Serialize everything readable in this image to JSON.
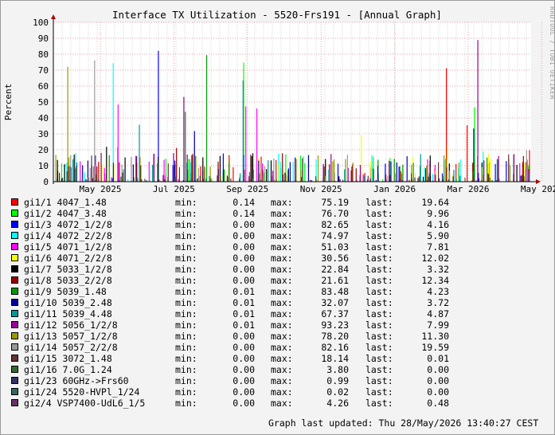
{
  "chart_data": {
    "type": "bar",
    "title": "Interface TX Utilization - 5520-Frs191 - [Annual Graph]",
    "ylabel": "Percent",
    "xlabel": "",
    "ylim": [
      0,
      100
    ],
    "yticks": [
      0,
      10,
      20,
      30,
      40,
      50,
      60,
      70,
      80,
      90,
      100
    ],
    "x_tick_labels": [
      "May 2025",
      "Jul 2025",
      "Sep 2025",
      "Nov 2025",
      "Jan 2026",
      "Mar 2026",
      "May 2026"
    ],
    "grid": true,
    "legend_placement": "bottom",
    "series": [
      {
        "name": "gi1/1 4047_1.48",
        "color": "#ff0000",
        "min": "0.14",
        "max": "75.19",
        "last": "19.64"
      },
      {
        "name": "gi1/2 4047_3.48",
        "color": "#00ff00",
        "min": "0.14",
        "max": "76.70",
        "last": "9.96"
      },
      {
        "name": "gi1/3 4072_1/2/8",
        "color": "#0000ff",
        "min": "0.00",
        "max": "82.65",
        "last": "4.16"
      },
      {
        "name": "gi1/4 4072_2/2/8",
        "color": "#00ffff",
        "min": "0.00",
        "max": "74.97",
        "last": "5.90"
      },
      {
        "name": "gi1/5 4071_1/2/8",
        "color": "#ff00ff",
        "min": "0.00",
        "max": "51.03",
        "last": "7.81"
      },
      {
        "name": "gi1/6 4071_2/2/8",
        "color": "#ffff00",
        "min": "0.00",
        "max": "30.56",
        "last": "12.02"
      },
      {
        "name": "gi1/7 5033_1/2/8",
        "color": "#000000",
        "min": "0.00",
        "max": "22.84",
        "last": "3.32"
      },
      {
        "name": "gi1/8 5033_2/2/8",
        "color": "#990000",
        "min": "0.00",
        "max": "21.61",
        "last": "12.34"
      },
      {
        "name": "gi1/9 5039_1.48",
        "color": "#009900",
        "min": "0.01",
        "max": "83.48",
        "last": "4.23"
      },
      {
        "name": "gi1/10 5039_2.48",
        "color": "#000099",
        "min": "0.01",
        "max": "32.07",
        "last": "3.72"
      },
      {
        "name": "gi1/11 5039_4.48",
        "color": "#009999",
        "min": "0.01",
        "max": "67.37",
        "last": "4.87"
      },
      {
        "name": "gi1/12 5056_1/2/8",
        "color": "#990099",
        "min": "0.01",
        "max": "93.23",
        "last": "7.99"
      },
      {
        "name": "gi1/13 5057_1/2/8",
        "color": "#999900",
        "min": "0.00",
        "max": "78.20",
        "last": "11.30"
      },
      {
        "name": "gi1/14 5057_2/2/8",
        "color": "#999999",
        "min": "0.00",
        "max": "82.16",
        "last": "19.59"
      },
      {
        "name": "gi1/15 3072_1.48",
        "color": "#663333",
        "min": "0.00",
        "max": "18.14",
        "last": "0.01"
      },
      {
        "name": "gi1/16 7.0G_1.24",
        "color": "#336633",
        "min": "0.00",
        "max": "3.80",
        "last": "0.00"
      },
      {
        "name": "gi1/23 60GHz->Frs60",
        "color": "#333366",
        "min": "0.00",
        "max": "0.99",
        "last": "0.00"
      },
      {
        "name": "gi1/24 5520-HVPl_1/24",
        "color": "#336666",
        "min": "0.00",
        "max": "0.02",
        "last": "0.00"
      },
      {
        "name": "gi2/4 VSP7400-UdL6_1/5",
        "color": "#663366",
        "min": "0.00",
        "max": "4.26",
        "last": "0.48"
      }
    ]
  },
  "legend_labels": {
    "min": "min:",
    "max": "max:",
    "last": "last:"
  },
  "footer": "Graph last updated: Thu 28/May/2026 13:40:27 CEST",
  "watermark": "RRDTOOL / TOBI OETIKER"
}
